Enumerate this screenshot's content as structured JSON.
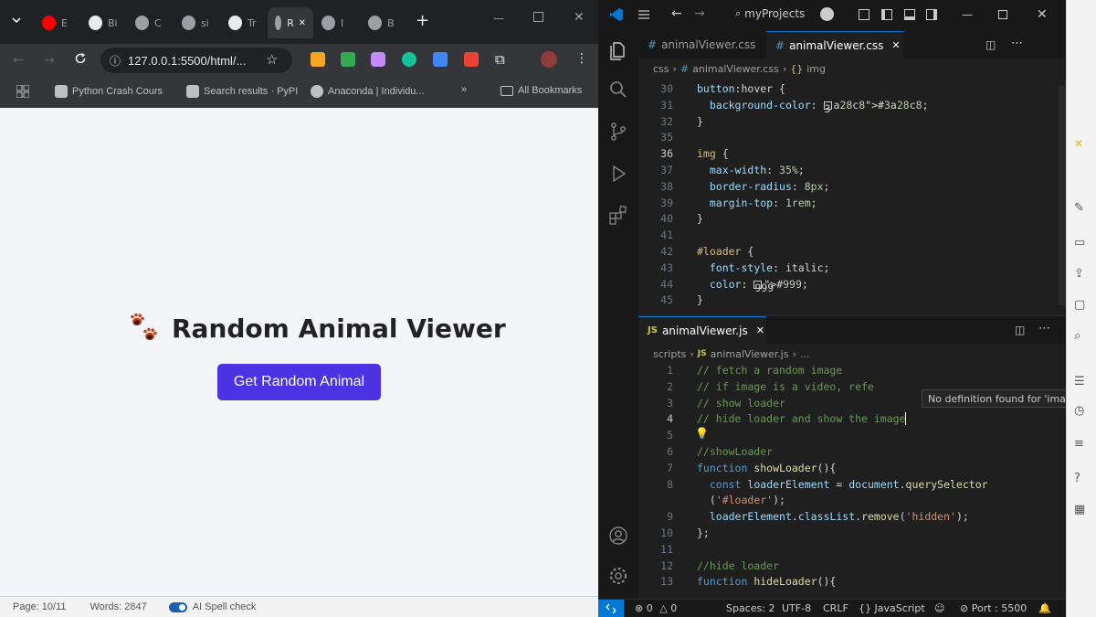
{
  "browser": {
    "tabs": [
      {
        "label": "E",
        "icon": "youtube-icon",
        "color": "#ff0000"
      },
      {
        "label": "Bi",
        "icon": "openai-icon",
        "color": "#e8eaed"
      },
      {
        "label": "C",
        "icon": "globe-icon",
        "color": "#9aa0a6"
      },
      {
        "label": "si",
        "icon": "globe-icon",
        "color": "#9aa0a6"
      },
      {
        "label": "Tr",
        "icon": "openai-icon",
        "color": "#e8eaed"
      },
      {
        "label": "R",
        "icon": "globe-icon",
        "color": "#9aa0a6",
        "active": true
      },
      {
        "label": "I",
        "icon": "gmail-icon",
        "color": "#9aa0a6"
      },
      {
        "label": "B",
        "icon": "globe-icon",
        "color": "#9aa0a6"
      }
    ],
    "url": "127.0.0.1:5500/html/...",
    "bookmarks": [
      "Python Crash Cours",
      "Search results · PyPI",
      "Anaconda | Individu...",
      "All Bookmarks"
    ],
    "page": {
      "title": "Random Animal Viewer",
      "button_label": "Get Random Animal"
    },
    "word_status": {
      "page": "Page: 10/11",
      "words": "Words: 2847",
      "spellcheck": "AI Spell check"
    }
  },
  "vscode": {
    "search": "myProjects",
    "top_tabs": [
      "animalViewer.css",
      "animalViewer.css"
    ],
    "top_breadcrumb": [
      "css",
      "animalViewer.css",
      "img"
    ],
    "css_lines": [
      {
        "n": "30",
        "text": "button:hover {"
      },
      {
        "n": "31",
        "text": "  background-color: #3a28c8;"
      },
      {
        "n": "32",
        "text": "}"
      },
      {
        "n": "35",
        "text": ""
      },
      {
        "n": "36",
        "text": "img {"
      },
      {
        "n": "37",
        "text": "  max-width: 35%;"
      },
      {
        "n": "38",
        "text": "  border-radius: 8px;"
      },
      {
        "n": "39",
        "text": "  margin-top: 1rem;"
      },
      {
        "n": "40",
        "text": "}"
      },
      {
        "n": "41",
        "text": ""
      },
      {
        "n": "42",
        "text": "#loader {"
      },
      {
        "n": "43",
        "text": "  font-style: italic;"
      },
      {
        "n": "44",
        "text": "  color: #999;"
      },
      {
        "n": "45",
        "text": "}"
      }
    ],
    "bottom_tab": "animalViewer.js",
    "bottom_breadcrumb": [
      "scripts",
      "animalViewer.js",
      "..."
    ],
    "js_lines": [
      {
        "n": "1",
        "text": "// fetch a random image"
      },
      {
        "n": "2",
        "text": "// if image is a video, refe"
      },
      {
        "n": "3",
        "text": "// show loader"
      },
      {
        "n": "4",
        "text": "// hide loader and show the image"
      },
      {
        "n": "5",
        "text": ""
      },
      {
        "n": "6",
        "text": "//showLoader"
      },
      {
        "n": "7",
        "text": "function showLoader(){"
      },
      {
        "n": "8",
        "text": "  const loaderElement = document.querySelector"
      },
      {
        "n": "",
        "text": "  ('#loader');"
      },
      {
        "n": "9",
        "text": "  loaderElement.classList.remove('hidden');"
      },
      {
        "n": "10",
        "text": "};"
      },
      {
        "n": "11",
        "text": ""
      },
      {
        "n": "12",
        "text": "//hide loader"
      },
      {
        "n": "13",
        "text": "function hideLoader(){"
      }
    ],
    "hover_tip": "No definition found for 'image'",
    "status": {
      "errors": "0",
      "warnings": "0",
      "spaces": "Spaces: 2",
      "encoding": "UTF-8",
      "eol": "CRLF",
      "language": "JavaScript",
      "port": "Port : 5500"
    }
  }
}
